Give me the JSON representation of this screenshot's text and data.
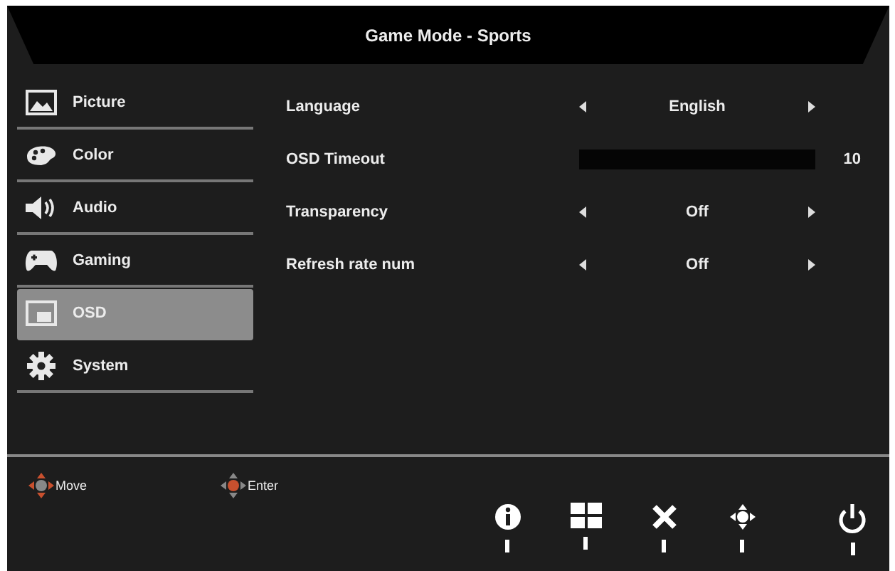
{
  "title": "Game Mode - Sports",
  "sidebar": {
    "items": [
      {
        "label": "Picture",
        "kind": "picture",
        "selected": false
      },
      {
        "label": "Color",
        "kind": "palette",
        "selected": false
      },
      {
        "label": "Audio",
        "kind": "speaker",
        "selected": false
      },
      {
        "label": "Gaming",
        "kind": "gamepad",
        "selected": false
      },
      {
        "label": "OSD",
        "kind": "osd",
        "selected": true
      },
      {
        "label": "System",
        "kind": "gear",
        "selected": false
      }
    ]
  },
  "settings": [
    {
      "kind": "choice",
      "label": "Language",
      "value": "English"
    },
    {
      "kind": "slider",
      "label": "OSD Timeout",
      "reading": "10"
    },
    {
      "kind": "choice",
      "label": "Transparency",
      "value": "Off"
    },
    {
      "kind": "choice",
      "label": "Refresh rate num",
      "value": "Off"
    }
  ],
  "hints": [
    {
      "label": "Move",
      "kind": "move"
    },
    {
      "label": "Enter",
      "kind": "enter"
    }
  ],
  "keys": [
    {
      "kind": "info"
    },
    {
      "kind": "grid"
    },
    {
      "kind": "close"
    },
    {
      "kind": "dpad"
    },
    {
      "kind": "power"
    }
  ]
}
